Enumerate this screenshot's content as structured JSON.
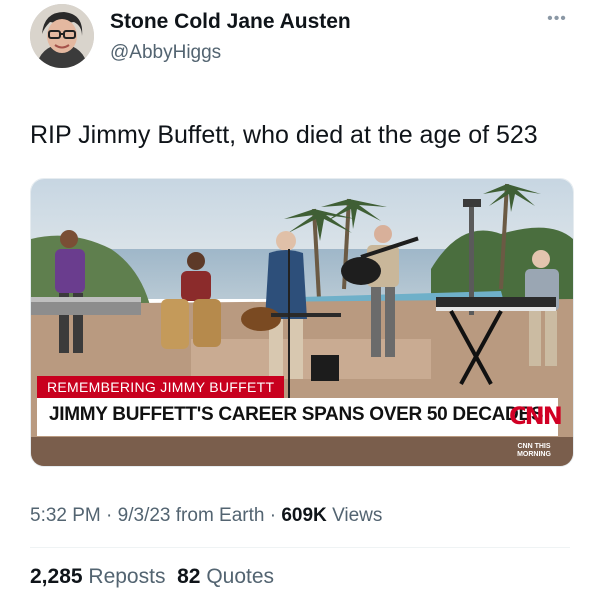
{
  "author": {
    "display_name": "Stone Cold Jane Austen",
    "handle": "@AbbyHiggs",
    "avatar_icon": "profile-photo"
  },
  "more_icon": "more-horizontal-icon",
  "tweet": {
    "text": "RIP Jimmy Buffett, who died at the age of 523"
  },
  "media": {
    "banner_label": "REMEMBERING JIMMY BUFFETT",
    "headline": "JIMMY BUFFETT'S CAREER SPANS OVER 50 DECADES",
    "network_logo": "CNN",
    "show_logo_line1": "CNN THIS",
    "show_logo_line2": "MORNING",
    "colors": {
      "banner_red": "#c8001e",
      "logo_red": "#d10024"
    }
  },
  "meta": {
    "time": "5:32 PM",
    "date": "9/3/23",
    "source": "from Earth",
    "sep": "·",
    "views_count": "609K",
    "views_label": "Views"
  },
  "stats": {
    "reposts_count": "2,285",
    "reposts_label": "Reposts",
    "quotes_count": "82",
    "quotes_label": "Quotes"
  }
}
